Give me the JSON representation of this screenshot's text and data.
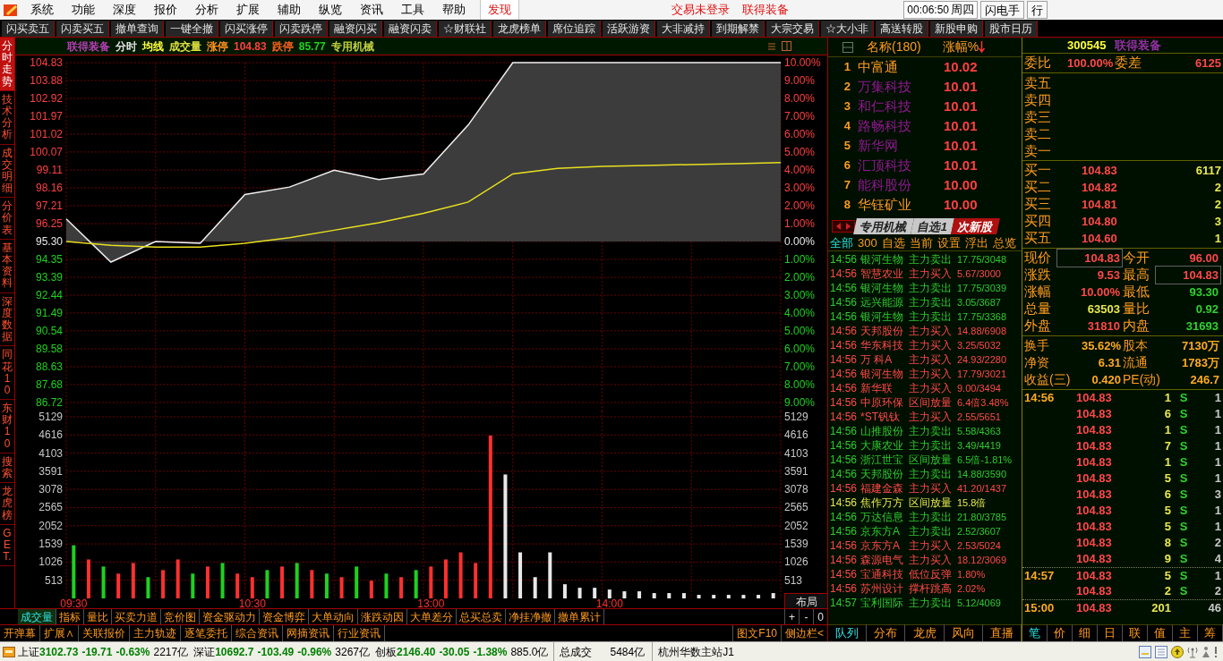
{
  "menu": {
    "items": [
      "系统",
      "功能",
      "深度",
      "报价",
      "分析",
      "扩展",
      "辅助",
      "纵览",
      "资讯",
      "工具",
      "帮助"
    ],
    "feature_link": "发现",
    "status": [
      "交易未登录",
      "联得装备"
    ],
    "clock": "00:06:50",
    "weekday": "周四",
    "buttons": [
      "闪电手",
      "行"
    ]
  },
  "toolbar": [
    "闪买卖五",
    "闪卖买五",
    "撤单查询",
    "一键全撤",
    "闪买涨停",
    "闪卖跌停",
    "融资闪买",
    "融资闪卖",
    "☆财联社",
    "龙虎榜单",
    "席位追踪",
    "活跃游资",
    "大非减持",
    "到期解禁",
    "大宗交易",
    "☆大小非",
    "高送转股",
    "新股申购",
    "股市日历"
  ],
  "side_tabs": [
    {
      "label": "分时走势",
      "selected": true
    },
    {
      "label": "技术分析",
      "selected": false
    },
    {
      "label": "成交明细",
      "selected": false
    },
    {
      "label": "分价表",
      "selected": false
    },
    {
      "label": "基本资料",
      "selected": false
    },
    {
      "label": "深度数据",
      "selected": false
    },
    {
      "label": "同花10",
      "selected": false
    },
    {
      "label": "东财10",
      "selected": false
    },
    {
      "label": "搜索",
      "selected": false
    },
    {
      "label": "龙虎榜",
      "selected": false
    },
    {
      "label": "GET.",
      "selected": false
    }
  ],
  "chart": {
    "header": [
      {
        "text": "联得装备",
        "color": "#b040b0"
      },
      {
        "text": "分时",
        "color": "#e0e0e0"
      },
      {
        "text": "均线",
        "color": "#ffff40"
      },
      {
        "text": "成交量",
        "color": "#e0e040"
      },
      {
        "text": "涨停",
        "color": "#ff9020"
      },
      {
        "text": "104.83",
        "color": "#ff4040"
      },
      {
        "text": "跌停",
        "color": "#ff6020"
      },
      {
        "text": "85.77",
        "color": "#20d020"
      },
      {
        "text": "专用机械",
        "color": "#c0d040"
      }
    ],
    "price_panel": {
      "chart_data": {
        "type": "line",
        "grid": true,
        "series": [
          {
            "color": "#f0f0f0",
            "values": [
              96.5,
              94.2,
              95.3,
              95.2,
              97.8,
              98.2,
              99.1,
              98.6,
              98.9,
              101.5,
              104.83,
              104.83,
              104.83,
              104.83,
              104.83,
              104.83,
              104.83
            ]
          },
          {
            "color": "#e8e020",
            "values": [
              95.3,
              95.1,
              95.0,
              95.0,
              95.2,
              95.5,
              95.9,
              96.3,
              96.8,
              97.4,
              98.9,
              99.2,
              99.3,
              99.35,
              99.4,
              99.45,
              99.5
            ]
          }
        ],
        "ylim": [
          86.72,
          104.83
        ],
        "yticks": [
          {
            "value": 104.83,
            "label": "104.83"
          },
          {
            "value": 103.88,
            "label": "103.88"
          },
          {
            "value": 102.92,
            "label": "102.92"
          },
          {
            "value": 101.97,
            "label": "101.97"
          },
          {
            "value": 101.02,
            "label": "101.02"
          },
          {
            "value": 100.07,
            "label": "100.07"
          },
          {
            "value": 99.11,
            "label": "99.11"
          },
          {
            "value": 98.16,
            "label": "98.16"
          },
          {
            "value": 97.21,
            "label": "97.21"
          },
          {
            "value": 96.25,
            "label": "96.25"
          },
          {
            "value": 95.3,
            "label": "95.30"
          },
          {
            "value": 94.35,
            "label": "94.35"
          },
          {
            "value": 93.39,
            "label": "93.39"
          },
          {
            "value": 92.44,
            "label": "92.44"
          },
          {
            "value": 91.49,
            "label": "91.49"
          },
          {
            "value": 90.54,
            "label": "90.54"
          },
          {
            "value": 89.58,
            "label": "89.58"
          },
          {
            "value": 88.63,
            "label": "88.63"
          },
          {
            "value": 87.68,
            "label": "87.68"
          },
          {
            "value": 86.72,
            "label": "86.72"
          }
        ]
      },
      "percent_ticks": [
        {
          "label": "10.00%",
          "kind": "up"
        },
        {
          "label": "9.00%",
          "kind": "up"
        },
        {
          "label": "8.00%",
          "kind": "up"
        },
        {
          "label": "7.00%",
          "kind": "up"
        },
        {
          "label": "6.00%",
          "kind": "up"
        },
        {
          "label": "5.00%",
          "kind": "up"
        },
        {
          "label": "4.00%",
          "kind": "up"
        },
        {
          "label": "3.00%",
          "kind": "up"
        },
        {
          "label": "2.00%",
          "kind": "up"
        },
        {
          "label": "1.00%",
          "kind": "up"
        },
        {
          "label": "0.00%",
          "kind": "flat"
        },
        {
          "label": "1.00%",
          "kind": "down"
        },
        {
          "label": "2.00%",
          "kind": "down"
        },
        {
          "label": "3.00%",
          "kind": "down"
        },
        {
          "label": "4.00%",
          "kind": "down"
        },
        {
          "label": "5.00%",
          "kind": "down"
        },
        {
          "label": "6.00%",
          "kind": "down"
        },
        {
          "label": "7.00%",
          "kind": "down"
        },
        {
          "label": "8.00%",
          "kind": "down"
        },
        {
          "label": "9.00%",
          "kind": "down"
        }
      ]
    },
    "volume_panel": {
      "chart_data": {
        "type": "bar",
        "grid": true,
        "categories": [
          "09:30",
          null,
          null,
          null,
          null,
          null,
          null,
          null,
          null,
          null,
          null,
          null,
          "10:30",
          null,
          null,
          null,
          null,
          null,
          null,
          null,
          null,
          null,
          null,
          null,
          "13:00",
          null,
          null,
          null,
          null,
          null,
          null,
          null,
          null,
          null,
          null,
          null,
          "14:00",
          null,
          null,
          null,
          null,
          null,
          null,
          null,
          null,
          null,
          null,
          null
        ],
        "series": [
          {
            "color": "#ff3030",
            "values": [
              null,
              1100,
              null,
              700,
              1000,
              null,
              800,
              1100,
              null,
              900,
              null,
              700,
              600,
              null,
              900,
              null,
              800,
              null,
              600,
              null,
              500,
              null,
              600,
              null,
              900,
              1100,
              1300,
              1000,
              4600,
              null,
              null,
              null,
              null,
              null,
              null,
              null,
              null,
              null,
              null,
              null,
              null,
              null,
              null,
              null,
              null,
              null,
              null,
              null
            ]
          },
          {
            "color": "#20d020",
            "values": [
              1500,
              null,
              900,
              null,
              null,
              600,
              null,
              null,
              700,
              null,
              1000,
              null,
              null,
              800,
              null,
              1000,
              null,
              700,
              null,
              900,
              null,
              700,
              null,
              800,
              null,
              null,
              null,
              null,
              null,
              null,
              null,
              null,
              null,
              null,
              null,
              null,
              null,
              null,
              null,
              null,
              null,
              null,
              null,
              null,
              null,
              null,
              null,
              null
            ]
          },
          {
            "color": "#e8e8e8",
            "values": [
              null,
              null,
              null,
              null,
              null,
              null,
              null,
              null,
              null,
              null,
              null,
              null,
              null,
              null,
              null,
              null,
              null,
              null,
              null,
              null,
              null,
              null,
              null,
              null,
              null,
              null,
              null,
              null,
              null,
              3500,
              1300,
              600,
              1300,
              400,
              300,
              300,
              250,
              200,
              200,
              150,
              150,
              150,
              100,
              100,
              100,
              100,
              100,
              150
            ]
          }
        ],
        "ylim": [
          0,
          5129
        ],
        "yticks": [
          {
            "value": 5129,
            "label": "5129"
          },
          {
            "value": 4616,
            "label": "4616"
          },
          {
            "value": 4103,
            "label": "4103"
          },
          {
            "value": 3591,
            "label": "3591"
          },
          {
            "value": 3078,
            "label": "3078"
          },
          {
            "value": 2565,
            "label": "2565"
          },
          {
            "value": 2052,
            "label": "2052"
          },
          {
            "value": 1539,
            "label": "1539"
          },
          {
            "value": 1026,
            "label": "1026"
          },
          {
            "value": 513,
            "label": "513"
          }
        ]
      },
      "right_ticks": [
        "5129",
        "4616",
        "4103",
        "3591",
        "3078",
        "2565",
        "2052",
        "1539",
        "1026",
        "513"
      ]
    },
    "layout_button": "布局"
  },
  "chart_tabs": [
    {
      "label": "成交量",
      "selected": true
    },
    {
      "label": "指标",
      "selected": false
    },
    {
      "label": "量比",
      "selected": false
    },
    {
      "label": "买卖力道",
      "selected": false
    },
    {
      "label": "竞价图",
      "selected": false
    },
    {
      "label": "资金驱动力",
      "selected": false
    },
    {
      "label": "资金博弈",
      "selected": false
    },
    {
      "label": "大单动向",
      "selected": false
    },
    {
      "label": "涨跌动因",
      "selected": false
    },
    {
      "label": "大单差分",
      "selected": false
    },
    {
      "label": "总买总卖",
      "selected": false
    },
    {
      "label": "净挂净撤",
      "selected": false
    },
    {
      "label": "撤单累计",
      "selected": false
    }
  ],
  "zoom_buttons": [
    "+",
    "-",
    "0"
  ],
  "extra_tabs": [
    "开弹幕",
    "扩展∧",
    "关联报价",
    "主力轨迹",
    "逐笔委托",
    "综合资讯",
    "网摘资讯",
    "行业资讯"
  ],
  "extra_right": [
    "图文F10",
    "侧边栏<"
  ],
  "rank_list": {
    "header_name": "名称(180)",
    "header_change": "涨幅%",
    "rows": [
      {
        "rank": "1",
        "name": "中富通",
        "change": "10.02",
        "color": "#ff9a20"
      },
      {
        "rank": "2",
        "name": "万集科技",
        "change": "10.01",
        "color": "#901890"
      },
      {
        "rank": "3",
        "name": "和仁科技",
        "change": "10.01",
        "color": "#901890"
      },
      {
        "rank": "4",
        "name": "路畅科技",
        "change": "10.01",
        "color": "#901890"
      },
      {
        "rank": "5",
        "name": "新华网",
        "change": "10.01",
        "color": "#901890"
      },
      {
        "rank": "6",
        "name": "汇顶科技",
        "change": "10.01",
        "color": "#901890"
      },
      {
        "rank": "7",
        "name": "能科股份",
        "change": "10.00",
        "color": "#901890"
      },
      {
        "rank": "8",
        "name": "华钰矿业",
        "change": "10.00",
        "color": "#ff9a20"
      }
    ]
  },
  "sector_tabs": [
    {
      "label": "专用机械",
      "selected": false
    },
    {
      "label": "自选1",
      "selected": false
    },
    {
      "label": "次新股",
      "selected": true
    }
  ],
  "filters": [
    {
      "label": "全部",
      "selected": true
    },
    {
      "label": "300",
      "selected": false
    },
    {
      "label": "自选",
      "selected": false
    },
    {
      "label": "当前",
      "selected": false
    },
    {
      "label": "设置",
      "selected": false
    },
    {
      "label": "浮出",
      "selected": false
    },
    {
      "label": "总览",
      "selected": false
    }
  ],
  "alerts": [
    {
      "time": "14:56",
      "name": "银河生物",
      "signal": "主力卖出",
      "value": "17.75/3048",
      "color": "#30c830"
    },
    {
      "time": "14:56",
      "name": "智慧农业",
      "signal": "主力买入",
      "value": "5.67/3000",
      "color": "#ff4848"
    },
    {
      "time": "14:56",
      "name": "银河生物",
      "signal": "主力卖出",
      "value": "17.75/3039",
      "color": "#30c830"
    },
    {
      "time": "14:56",
      "name": "远兴能源",
      "signal": "主力卖出",
      "value": "3.05/3687",
      "color": "#30c830"
    },
    {
      "time": "14:56",
      "name": "银河生物",
      "signal": "主力卖出",
      "value": "17.75/3368",
      "color": "#30c830"
    },
    {
      "time": "14:56",
      "name": "天邦股份",
      "signal": "主力买入",
      "value": "14.88/6908",
      "color": "#ff4848"
    },
    {
      "time": "14:56",
      "name": "华东科技",
      "signal": "主力买入",
      "value": "3.25/5032",
      "color": "#ff4848"
    },
    {
      "time": "14:56",
      "name": "万 科A",
      "signal": "主力买入",
      "value": "24.93/2280",
      "color": "#ff4848"
    },
    {
      "time": "14:56",
      "name": "银河生物",
      "signal": "主力买入",
      "value": "17.79/3021",
      "color": "#ff4848"
    },
    {
      "time": "14:56",
      "name": "新华联",
      "signal": "主力买入",
      "value": "9.00/3494",
      "color": "#ff4848"
    },
    {
      "time": "14:56",
      "name": "中原环保",
      "signal": "区间放量",
      "value": "6.4倍3.48%",
      "color": "#ff4848"
    },
    {
      "time": "14:56",
      "name": "*ST钒钛",
      "signal": "主力买入",
      "value": "2.55/5651",
      "color": "#ff4848"
    },
    {
      "time": "14:56",
      "name": "山推股份",
      "signal": "主力卖出",
      "value": "5.58/4363",
      "color": "#30c830"
    },
    {
      "time": "14:56",
      "name": "大康农业",
      "signal": "主力卖出",
      "value": "3.49/4419",
      "color": "#30c830"
    },
    {
      "time": "14:56",
      "name": "浙江世宝",
      "signal": "区间放量",
      "value": "6.5倍-1.81%",
      "color": "#30c830"
    },
    {
      "time": "14:56",
      "name": "天邦股份",
      "signal": "主力卖出",
      "value": "14.88/3590",
      "color": "#30c830"
    },
    {
      "time": "14:56",
      "name": "福建金森",
      "signal": "主力买入",
      "value": "41.20/1437",
      "color": "#ff4848"
    },
    {
      "time": "14:56",
      "name": "焦作万方",
      "signal": "区间放量",
      "value": "15.8倍",
      "color": "#e8e850"
    },
    {
      "time": "14:56",
      "name": "万达信息",
      "signal": "主力卖出",
      "value": "21.80/3785",
      "color": "#30c830"
    },
    {
      "time": "14:56",
      "name": "京东方A",
      "signal": "主力卖出",
      "value": "2.52/3607",
      "color": "#30c830"
    },
    {
      "time": "14:56",
      "name": "京东方A",
      "signal": "主力买入",
      "value": "2.53/5024",
      "color": "#ff4848"
    },
    {
      "time": "14:56",
      "name": "森源电气",
      "signal": "主力买入",
      "value": "18.12/3069",
      "color": "#ff4848"
    },
    {
      "time": "14:56",
      "name": "宝通科技",
      "signal": "低位反弹",
      "value": "1.80%",
      "color": "#ff4848"
    },
    {
      "time": "14:56",
      "name": "苏州设计",
      "signal": "撑杆跳高",
      "value": "2.02%",
      "color": "#ff4848"
    },
    {
      "time": "14:57",
      "name": "宝利国际",
      "signal": "主力卖出",
      "value": "5.12/4069",
      "color": "#30c830"
    }
  ],
  "list_tabs": [
    {
      "label": "队列",
      "selected": true
    },
    {
      "label": "分布",
      "selected": false
    },
    {
      "label": "龙虎",
      "selected": false
    },
    {
      "label": "风向",
      "selected": false
    },
    {
      "label": "直播",
      "selected": false
    }
  ],
  "quote": {
    "code": "300545",
    "name": "联得装备",
    "ratio_label": "委比",
    "ratio": "100.00%",
    "diff_label": "委差",
    "diff": "6125",
    "asks": [
      "卖五",
      "卖四",
      "卖三",
      "卖二",
      "卖一"
    ],
    "bids": [
      {
        "label": "买一",
        "price": "104.83",
        "volume": "6117"
      },
      {
        "label": "买二",
        "price": "104.82",
        "volume": "2"
      },
      {
        "label": "买三",
        "price": "104.81",
        "volume": "2"
      },
      {
        "label": "买四",
        "price": "104.80",
        "volume": "3"
      },
      {
        "label": "买五",
        "price": "104.60",
        "volume": "1"
      }
    ],
    "stats": [
      {
        "label": "现价",
        "value": "104.83",
        "color": "#ff4848",
        "boxed": true
      },
      {
        "label": "今开",
        "value": "96.00",
        "color": "#ff4848",
        "boxed": false
      },
      {
        "label": "涨跌",
        "value": "9.53",
        "color": "#ff4848",
        "boxed": false
      },
      {
        "label": "最高",
        "value": "104.83",
        "color": "#ff4848",
        "boxed": true
      },
      {
        "label": "涨幅",
        "value": "10.00%",
        "color": "#ff4848",
        "boxed": false
      },
      {
        "label": "最低",
        "value": "93.30",
        "color": "#30d030",
        "boxed": false
      },
      {
        "label": "总量",
        "value": "63503",
        "color": "#e8e850",
        "boxed": false
      },
      {
        "label": "量比",
        "value": "0.92",
        "color": "#30d030",
        "boxed": false
      },
      {
        "label": "外盘",
        "value": "31810",
        "color": "#ff4848",
        "boxed": false
      },
      {
        "label": "内盘",
        "value": "31693",
        "color": "#30d030",
        "boxed": false
      }
    ],
    "fundamentals": [
      {
        "label": "换手",
        "value": "35.62%"
      },
      {
        "label": "股本",
        "value": "7130万"
      },
      {
        "label": "净资",
        "value": "6.31"
      },
      {
        "label": "流通",
        "value": "1783万"
      },
      {
        "label": "收益(三)",
        "value": "0.420"
      },
      {
        "label": "PE(动)",
        "value": "246.7"
      }
    ],
    "ticks": [
      {
        "time": "14:56",
        "price": "104.83",
        "volume": "1",
        "side": "S",
        "count": "1"
      },
      {
        "price": "104.83",
        "volume": "6",
        "side": "S",
        "count": "1"
      },
      {
        "price": "104.83",
        "volume": "1",
        "side": "S",
        "count": "1"
      },
      {
        "price": "104.83",
        "volume": "7",
        "side": "S",
        "count": "1"
      },
      {
        "price": "104.83",
        "volume": "1",
        "side": "S",
        "count": "1"
      },
      {
        "price": "104.83",
        "volume": "5",
        "side": "S",
        "count": "1"
      },
      {
        "price": "104.83",
        "volume": "6",
        "side": "S",
        "count": "3"
      },
      {
        "price": "104.83",
        "volume": "5",
        "side": "S",
        "count": "1"
      },
      {
        "price": "104.83",
        "volume": "5",
        "side": "S",
        "count": "1"
      },
      {
        "price": "104.83",
        "volume": "8",
        "side": "S",
        "count": "2"
      },
      {
        "price": "104.83",
        "volume": "9",
        "side": "S",
        "count": "4"
      },
      {
        "time": "14:57",
        "price": "104.83",
        "volume": "5",
        "side": "S",
        "count": "1"
      },
      {
        "price": "104.83",
        "volume": "2",
        "side": "S",
        "count": "2"
      },
      {
        "time": "15:00",
        "price": "104.83",
        "volume": "201",
        "count": "46"
      }
    ]
  },
  "quote_tabs": [
    {
      "label": "笔",
      "selected": true
    },
    {
      "label": "价",
      "selected": false
    },
    {
      "label": "细",
      "selected": false
    },
    {
      "label": "日",
      "selected": false
    },
    {
      "label": "联",
      "selected": false
    },
    {
      "label": "值",
      "selected": false
    },
    {
      "label": "主",
      "selected": false
    },
    {
      "label": "筹",
      "selected": false
    }
  ],
  "status_bar": {
    "indices": [
      {
        "name": "上证",
        "value": "3102.73",
        "change": "-19.71",
        "pct": "-0.63%",
        "amount": "2217亿"
      },
      {
        "name": "深证",
        "value": "10692.7",
        "change": "-103.49",
        "pct": "-0.96%",
        "amount": "3267亿"
      },
      {
        "name": "创板",
        "value": "2146.40",
        "change": "-30.05",
        "pct": "-1.38%",
        "amount": "885.0亿"
      }
    ],
    "total_label": "总成交",
    "total": "5484亿",
    "server": "杭州华数主站J1"
  }
}
